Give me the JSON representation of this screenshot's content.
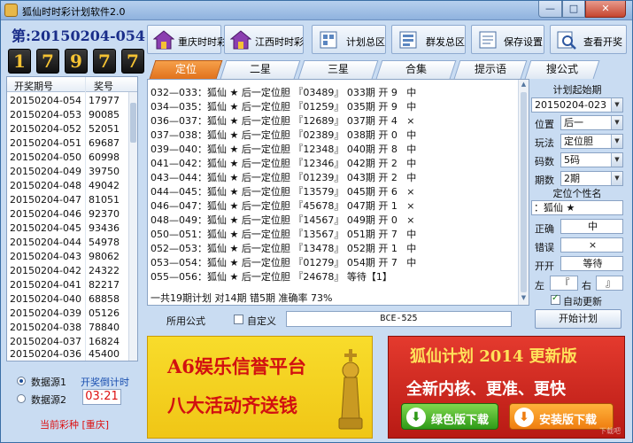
{
  "window": {
    "title": "狐仙时时彩计划软件2.0",
    "min": "—",
    "max": "□",
    "close": "✕"
  },
  "header": {
    "period_label": "第:20150204-054 期",
    "balls": [
      "1",
      "7",
      "9",
      "7",
      "7"
    ]
  },
  "toolbar": [
    {
      "label": "重庆时时彩",
      "icon": "house-icon"
    },
    {
      "label": "江西时时彩",
      "icon": "house-icon"
    },
    {
      "label": "计划总区",
      "icon": "grid-icon"
    },
    {
      "label": "群发总区",
      "icon": "grid-icon"
    },
    {
      "label": "保存设置",
      "icon": "save-icon"
    },
    {
      "label": "查看开奖",
      "icon": "search-icon"
    }
  ],
  "history": {
    "col_period": "开奖期号",
    "col_number": "奖号",
    "rows": [
      [
        "20150204-054",
        "17977"
      ],
      [
        "20150204-053",
        "90085"
      ],
      [
        "20150204-052",
        "52051"
      ],
      [
        "20150204-051",
        "69687"
      ],
      [
        "20150204-050",
        "60998"
      ],
      [
        "20150204-049",
        "39750"
      ],
      [
        "20150204-048",
        "49042"
      ],
      [
        "20150204-047",
        "81051"
      ],
      [
        "20150204-046",
        "92370"
      ],
      [
        "20150204-045",
        "93436"
      ],
      [
        "20150204-044",
        "54978"
      ],
      [
        "20150204-043",
        "98062"
      ],
      [
        "20150204-042",
        "24322"
      ],
      [
        "20150204-041",
        "82217"
      ],
      [
        "20150204-040",
        "68858"
      ],
      [
        "20150204-039",
        "05126"
      ],
      [
        "20150204-038",
        "78840"
      ],
      [
        "20150204-037",
        "16824"
      ],
      [
        "20150204-036",
        "45400"
      ]
    ]
  },
  "source": {
    "option1": "数据源1",
    "option2": "数据源2",
    "countdown_label": "开奖倒计时",
    "countdown": "03:21",
    "current_lottery": "当前彩种 [重庆]"
  },
  "tabs": [
    "定位",
    "二星",
    "三星",
    "合集",
    "提示语",
    "搜公式"
  ],
  "plan_lines": [
    "032—033：狐仙 ★ 后一定位胆 『03489』 033期 开 9   中",
    "034—035：狐仙 ★ 后一定位胆 『01259』 035期 开 9   中",
    "036—037：狐仙 ★ 后一定位胆 『12689』 037期 开 4   ×",
    "037—038：狐仙 ★ 后一定位胆 『02389』 038期 开 0   中",
    "039—040：狐仙 ★ 后一定位胆 『12348』 040期 开 8   中",
    "041—042：狐仙 ★ 后一定位胆 『12346』 042期 开 2   中",
    "043—044：狐仙 ★ 后一定位胆 『01239』 043期 开 2   中",
    "044—045：狐仙 ★ 后一定位胆 『13579』 045期 开 6   ×",
    "046—047：狐仙 ★ 后一定位胆 『45678』 047期 开 1   ×",
    "048—049：狐仙 ★ 后一定位胆 『14567』 049期 开 0   ×",
    "050—051：狐仙 ★ 后一定位胆 『13567』 051期 开 7   中",
    "052—053：狐仙 ★ 后一定位胆 『13478』 052期 开 1   中",
    "053—054：狐仙 ★ 后一定位胆 『01279』 054期 开 7   中",
    "055—056：狐仙 ★ 后一定位胆 『24678』 等待【1】"
  ],
  "summary": "一共19期计划 对14期 错5期 准确率 73%",
  "formula": {
    "label": "所用公式",
    "custom_label": "自定义",
    "code": "BCE-525"
  },
  "panel": {
    "start_title": "计划起始期",
    "start_value": "20150204-023",
    "position_label": "位置",
    "position_value": "后一",
    "play_label": "玩法",
    "play_value": "定位胆",
    "count_label": "码数",
    "count_value": "5码",
    "period_label": "期数",
    "period_value": "2期",
    "sig_title": "定位个性名",
    "sig_value": "：狐仙 ★",
    "correct_label": "正确",
    "correct_value": "中",
    "wrong_label": "错误",
    "wrong_value": "×",
    "open_label": "开开",
    "open_value": "等待",
    "left_label": "左",
    "left_value": "『",
    "right_label": "右",
    "right_value": "』",
    "auto_update": "自动更新",
    "start_button": "开始计划"
  },
  "ad_left": {
    "line1": "A6娱乐信誉平台",
    "line2": "八大活动齐送钱"
  },
  "ad_right": {
    "line1": "狐仙计划 2014 更新版",
    "line2": "全新内核、更准、更快",
    "green_btn": "绿色版下载",
    "orange_btn": "安装版下载",
    "download_glyph": "⬇",
    "watermark": "下载吧"
  }
}
